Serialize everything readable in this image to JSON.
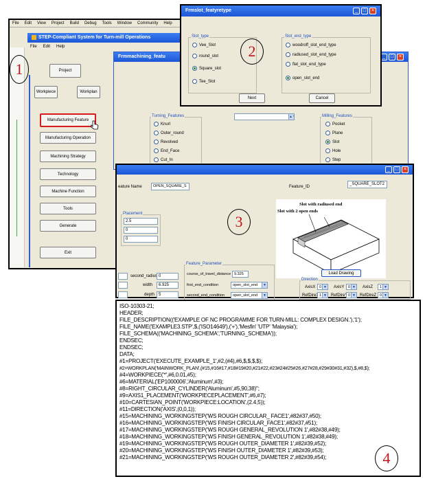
{
  "main_window": {
    "menu": [
      "File",
      "Edit",
      "View",
      "Project",
      "Build",
      "Debug",
      "Tools",
      "Window",
      "Community",
      "Help"
    ],
    "title": "STEP-Compliant System for Turn-mill Operations",
    "sub_menu": [
      "File",
      "Edit",
      "Help"
    ],
    "buttons": {
      "project": "Project",
      "workpiece": "Workpiece",
      "workplan": "Workplan",
      "manufacturing_feature": "Manufacturing Feature",
      "manufacturing_operation": "Manufacturing Operation",
      "machining_strategy": "Machining Strategy",
      "technology": "Technology",
      "machine_function": "Machine Function",
      "tools": "Tools",
      "generate": "Generate",
      "exit": "Exit"
    }
  },
  "feature_window": {
    "title": "Frmmachining_featu",
    "turning_features_title": "Turning_Features",
    "turning_features": [
      "Knurl",
      "Outer_round",
      "Revolved",
      "End_Face",
      "Cut_In"
    ],
    "milling_features_title": "Milling_Features",
    "milling_features": [
      "Pocket",
      "Plane",
      "Slot",
      "Hole",
      "Step"
    ],
    "milling_selected": "Slot"
  },
  "slot_type_dialog": {
    "title": "Frmslot_featyretype",
    "slot_type_title": "Slot_type",
    "slot_types": [
      "Vee_Slot",
      "round_slot",
      "Square_slot",
      "Tee_Slot"
    ],
    "slot_type_selected": "Square_slot",
    "slot_end_title": "Slot_end_type",
    "slot_end_types": [
      "woodroff_slot_end_type",
      "radiused_slot_end_type",
      "flat_slot_end_type",
      "open_slot_end"
    ],
    "slot_end_selected": "open_slot_end",
    "next_label": "Next",
    "cancel_label": "Cancel"
  },
  "slot_detail_window": {
    "feature_name_label": "eature Name",
    "feature_name_value": "OPEN_SQUARE_S",
    "feature_id_label": "Feature_ID",
    "feature_id_value": "_SQUARE_SLOT2",
    "placement_title": "Placement",
    "placement_values": [
      "2.5",
      "0",
      "0"
    ],
    "image_caption_top": "Slot with radiused end",
    "image_caption_left": "Slot with 2 open ends",
    "load_drawing_label": "Load Drawing",
    "second_radius_label": "second_radius",
    "second_radius_value": "0",
    "width_label": "width",
    "width_value": "6.925",
    "depth_label": "depth",
    "depth_value": "5",
    "parameter_title": "Feature_Parameter",
    "course_label": "course_of_travel_distance",
    "course_value": "9.325",
    "first_end_label": "first_end_condition",
    "first_end_value": "open_slot_end",
    "second_end_label": "second_end_condition",
    "second_end_value": "open_slot_end",
    "direction_title": "Direction",
    "axis_labels": [
      "AxisX",
      "AxisY",
      "AxisZ"
    ],
    "axis_values": [
      "0",
      "0",
      "1"
    ],
    "ref_labels": [
      "RefDireX",
      "RefDireY",
      "RefDireZ"
    ],
    "ref_values": [
      "1",
      "0",
      "0"
    ]
  },
  "code_listing": {
    "lines": [
      "ISO-10303-21;",
      "HEADER;",
      "FILE_DESCRIPTION(('EXAMPLE OF NC PROGRAMME FOR TURN-MILL: COMPLEX DESIGN.'),'1');",
      "FILE_NAME('EXAMPLE3.STP',$,('ISO14649'),('+'),'Mesfin'    'UTP'    'Malaysia');",
      "FILE_SCHEMA(('MACHINING_SCHEMA','TURNING_SCHEMA'));",
      "ENDSEC;",
      "ENDSEC;",
      "DATA;",
      "#1=PROJECT('EXECUTE_EXAMPLE_1',#2,(#4),#6,$,$,$,$);",
      "#2=WORKPLAN('MAINWORK_PLAN',(#15,#16#17,#18#19#20,#21#22,#23#24#25#26,#27#28,#29#30#31,#32),$,#8,$);",
      "#4=WORKPIECE('*',#6,0.01,#5);",
      "#6=MATERIAL('EP1000006','Aluminum',#3);",
      "#8=RIGHT_CIRCULAR_CYLINDER('Aluminum',#5,90,38)\";",
      "#9=AXIS1_PLACEMENT('WORKPIECEPLACEMENT',#6,#7);",
      "#10=CARTESIAN_POINT('WORKPIECE:LOCATION',(2.4,5));",
      "#11=DIRECTION('AXIS',(0,0,1));",
      "#15=MACHINING_WORKINGSTEP('WS ROUGH CIRCULAR_ FACE1',#82#37,#50);",
      "#16=MACHINING_WORKINGSTEP('WS FINISH CIRCULAR_FACE1',#82#37,#51);",
      "#17=MACHINING_WORKINGSTEP('WS ROUGH GENERAL_REVOLUTION 1',#82#38,#49);",
      "#18=MACHINING_WORKINGSTEP('WS FINISH GENERAL_REVOLUTION 1',#82#38,#49);",
      "#19=MACHINING_WORKINGSTEP('WS ROUGH OUTER_DIAMETER 1',#82#39,#52);",
      "#20=MACHINING_WORKINGSTEP('WS FINISH OUTER_DIAMETER 1',#82#39,#53);",
      "#21=MACHINING_WORKINGSTEP('WS ROUGH OUTER_DIAMETER 2',#82#39,#54);"
    ]
  },
  "callouts": [
    "1",
    "2",
    "3",
    "4"
  ],
  "colors": {
    "xp_title": "#1c56d6",
    "callout_text": "#c0141c",
    "panel": "#ece9d8",
    "highlight_border": "#d81a1a"
  }
}
